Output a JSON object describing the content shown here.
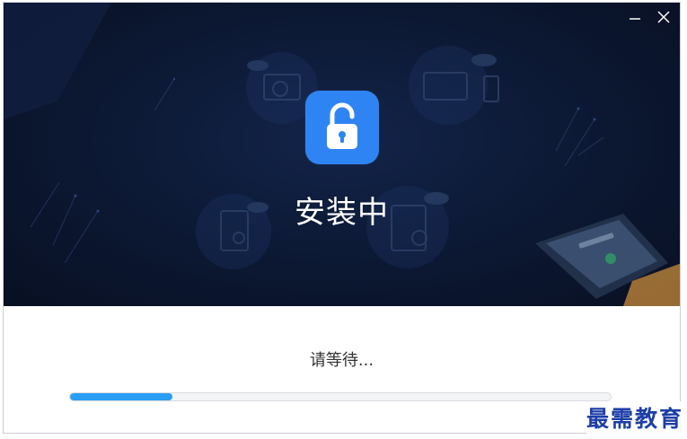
{
  "window": {
    "minimize_label": "—",
    "close_label": "✕"
  },
  "hero": {
    "title": "安装中",
    "app_icon": "unlocked-padlock-icon"
  },
  "footer": {
    "status_text": "请等待...",
    "progress_fraction": 0.19
  },
  "watermark": {
    "text": "最需教育"
  },
  "colors": {
    "hero_background": "#0d1a36",
    "app_icon_blue": "#2f84f4",
    "progress_blue": "#2a9df4",
    "watermark_blue": "#1d3ea8"
  }
}
